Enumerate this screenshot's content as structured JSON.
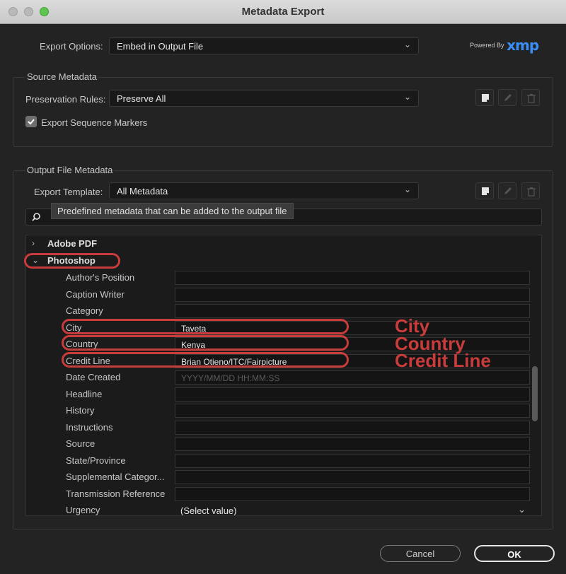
{
  "window": {
    "title": "Metadata Export"
  },
  "export_options": {
    "label": "Export Options:",
    "value": "Embed in Output File"
  },
  "branding": {
    "powered_by": "Powered By",
    "logo": "xmp",
    "logo_color": "#3a8ef6"
  },
  "source_metadata": {
    "title": "Source Metadata",
    "preservation_label": "Preservation Rules:",
    "preservation_value": "Preserve All",
    "export_markers_label": "Export Sequence Markers",
    "export_markers_checked": true
  },
  "output_metadata": {
    "title": "Output File Metadata",
    "template_label": "Export Template:",
    "template_value": "All Metadata",
    "search_placeholder": "",
    "tooltip": "Predefined metadata that can be added to the output file"
  },
  "tree": {
    "sections": [
      {
        "label": "Adobe PDF",
        "expanded": false
      },
      {
        "label": "Photoshop",
        "expanded": true
      }
    ],
    "photoshop_fields": [
      {
        "label": "Author's Position",
        "value": ""
      },
      {
        "label": "Caption Writer",
        "value": ""
      },
      {
        "label": "Category",
        "value": ""
      },
      {
        "label": "City",
        "value": "Taveta"
      },
      {
        "label": "Country",
        "value": "Kenya"
      },
      {
        "label": "Credit Line",
        "value": "Brian Otieno/ITC/Fairpicture"
      },
      {
        "label": "Date Created",
        "value": "",
        "placeholder": "YYYY/MM/DD HH:MM:SS"
      },
      {
        "label": "Headline",
        "value": ""
      },
      {
        "label": "History",
        "value": ""
      },
      {
        "label": "Instructions",
        "value": ""
      },
      {
        "label": "Source",
        "value": ""
      },
      {
        "label": "State/Province",
        "value": ""
      },
      {
        "label": "Supplemental Categor...",
        "value": ""
      },
      {
        "label": "Transmission Reference",
        "value": ""
      },
      {
        "label": "Urgency",
        "value": "(Select value)"
      }
    ]
  },
  "annotations": {
    "city": "City",
    "country": "Country",
    "credit_line": "Credit Line",
    "color": "#c83c3c"
  },
  "buttons": {
    "cancel": "Cancel",
    "ok": "OK"
  },
  "icons": {
    "new_preset": "new-preset-icon",
    "edit": "pencil-icon",
    "delete": "trash-icon",
    "search": "search-icon",
    "dropdown": "chevron-down-icon",
    "expand": "chevron-right-icon",
    "collapse": "chevron-down-icon"
  }
}
